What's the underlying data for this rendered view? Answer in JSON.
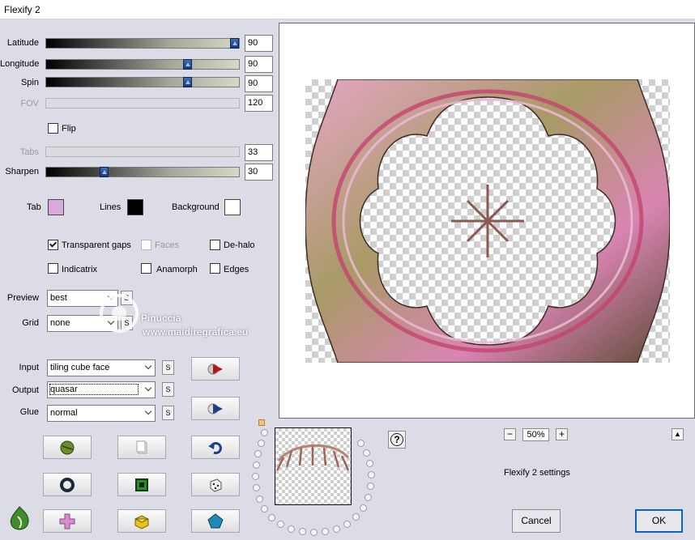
{
  "window": {
    "title": "Flexify 2"
  },
  "sliders": [
    {
      "id": "latitude",
      "label": "Latitude",
      "value": "90",
      "pos": 0.98,
      "enabled": true
    },
    {
      "id": "longitude",
      "label": "Longitude",
      "value": "90",
      "pos": 0.73,
      "enabled": true
    },
    {
      "id": "spin",
      "label": "Spin",
      "value": "90",
      "pos": 0.73,
      "enabled": true
    },
    {
      "id": "fov",
      "label": "FOV",
      "value": "120",
      "pos": null,
      "enabled": false
    },
    {
      "id": "tabs",
      "label": "Tabs",
      "value": "33",
      "pos": null,
      "enabled": false
    },
    {
      "id": "sharpen",
      "label": "Sharpen",
      "value": "30",
      "pos": 0.3,
      "enabled": true
    }
  ],
  "flip": {
    "label": "Flip",
    "checked": false
  },
  "colors": {
    "tab_label": "Tab",
    "tab_color": "#d9a8dc",
    "lines_label": "Lines",
    "lines_color": "#000000",
    "background_label": "Background",
    "background_color": "#ffffff"
  },
  "checkboxes": [
    {
      "id": "transparent-gaps",
      "label": "Transparent gaps",
      "checked": true,
      "enabled": true
    },
    {
      "id": "faces",
      "label": "Faces",
      "checked": false,
      "enabled": false
    },
    {
      "id": "de-halo",
      "label": "De-halo",
      "checked": false,
      "enabled": true
    },
    {
      "id": "indicatrix",
      "label": "Indicatrix",
      "checked": false,
      "enabled": true
    },
    {
      "id": "anamorph",
      "label": "Anamorph",
      "checked": false,
      "enabled": true
    },
    {
      "id": "edges",
      "label": "Edges",
      "checked": false,
      "enabled": true
    }
  ],
  "selects": {
    "preview": {
      "label": "Preview",
      "value": "best"
    },
    "grid": {
      "label": "Grid",
      "value": "none"
    },
    "input": {
      "label": "Input",
      "value": "tiling cube face"
    },
    "output": {
      "label": "Output",
      "value": "quasar"
    },
    "glue": {
      "label": "Glue",
      "value": "normal"
    },
    "s_label": "S"
  },
  "watermark": {
    "name": "Pinuccia",
    "site": "www.maidiregrafica.eu"
  },
  "zoom": {
    "value": "50%",
    "minus": "−",
    "plus": "+"
  },
  "collapse_label": "▲",
  "help_label": "?",
  "settings_label": "Flexify 2 settings",
  "buttons": {
    "cancel": "Cancel",
    "ok": "OK"
  }
}
